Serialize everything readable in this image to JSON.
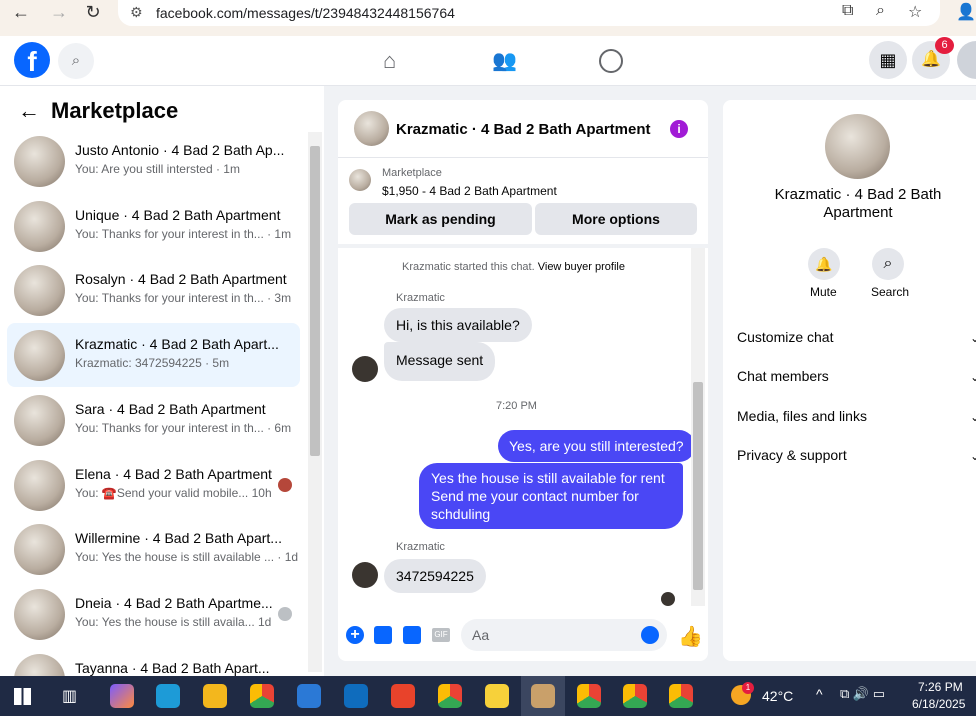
{
  "browser": {
    "url": "facebook.com/messages/t/23948432448156764"
  },
  "sidebar": {
    "title": "Marketplace",
    "conversations": [
      {
        "name": "Justo Antonio · 4 Bad 2 Bath Ap...",
        "snippet": "You: Are you still intersted · 1m"
      },
      {
        "name": "Unique · 4 Bad 2 Bath Apartment",
        "snippet": "You: Thanks for your interest in th... · 1m"
      },
      {
        "name": "Rosalyn · 4 Bad 2 Bath Apartment",
        "snippet": "You: Thanks for your interest in th... · 3m"
      },
      {
        "name": "Krazmatic · 4 Bad 2 Bath Apart...",
        "snippet": "Krazmatic: 3472594225 · 5m"
      },
      {
        "name": "Sara · 4 Bad 2 Bath Apartment",
        "snippet": "You: Thanks for your interest in th... · 6m"
      },
      {
        "name": "Elena · 4 Bad 2 Bath Apartment",
        "snippet": "You: ☎️Send your valid mobile... 10h"
      },
      {
        "name": "Willermine · 4 Bad 2 Bath Apart...",
        "snippet": "You: Yes the house is still available ... · 1d"
      },
      {
        "name": "Dneia · 4 Bad 2 Bath Apartme...",
        "snippet": "You: Yes the house is still availa...   1d"
      },
      {
        "name": "Tayanna · 4 Bad 2 Bath Apart...",
        "snippet": ""
      }
    ]
  },
  "chat": {
    "title": "Krazmatic · 4 Bad 2 Bath Apartment",
    "listing_label": "Marketplace",
    "listing_price": "$1,950 - 4 Bad 2 Bath Apartment",
    "btn_pending": "Mark as pending",
    "btn_more": "More options",
    "started": "Krazmatic started this chat.",
    "view_profile": "View buyer profile",
    "sender1": "Krazmatic",
    "msg1": "Hi, is this available?",
    "msg2": "Message sent",
    "time": "7:20 PM",
    "msg3": "Yes, are you still interested?",
    "msg4_l1": "Yes the house is still available for rent",
    "msg4_l2": "Send me your contact number for",
    "msg4_l3": "schduling",
    "sender2": "Krazmatic",
    "msg5": "3472594225",
    "composer_placeholder": "Aa"
  },
  "details": {
    "title": "Krazmatic · 4 Bad 2 Bath Apartment",
    "mute": "Mute",
    "search": "Search",
    "sections": [
      "Customize chat",
      "Chat members",
      "Media, files and links",
      "Privacy & support"
    ]
  },
  "topbar": {
    "notifications": "6"
  },
  "taskbar": {
    "temp": "42°C",
    "time": "7:26 PM",
    "date": "6/18/2025",
    "weather_badge": "1"
  },
  "colors": {
    "fb_blue": "#0866ff",
    "outgoing": "#4a47f5",
    "badge": "#e41e3f"
  }
}
